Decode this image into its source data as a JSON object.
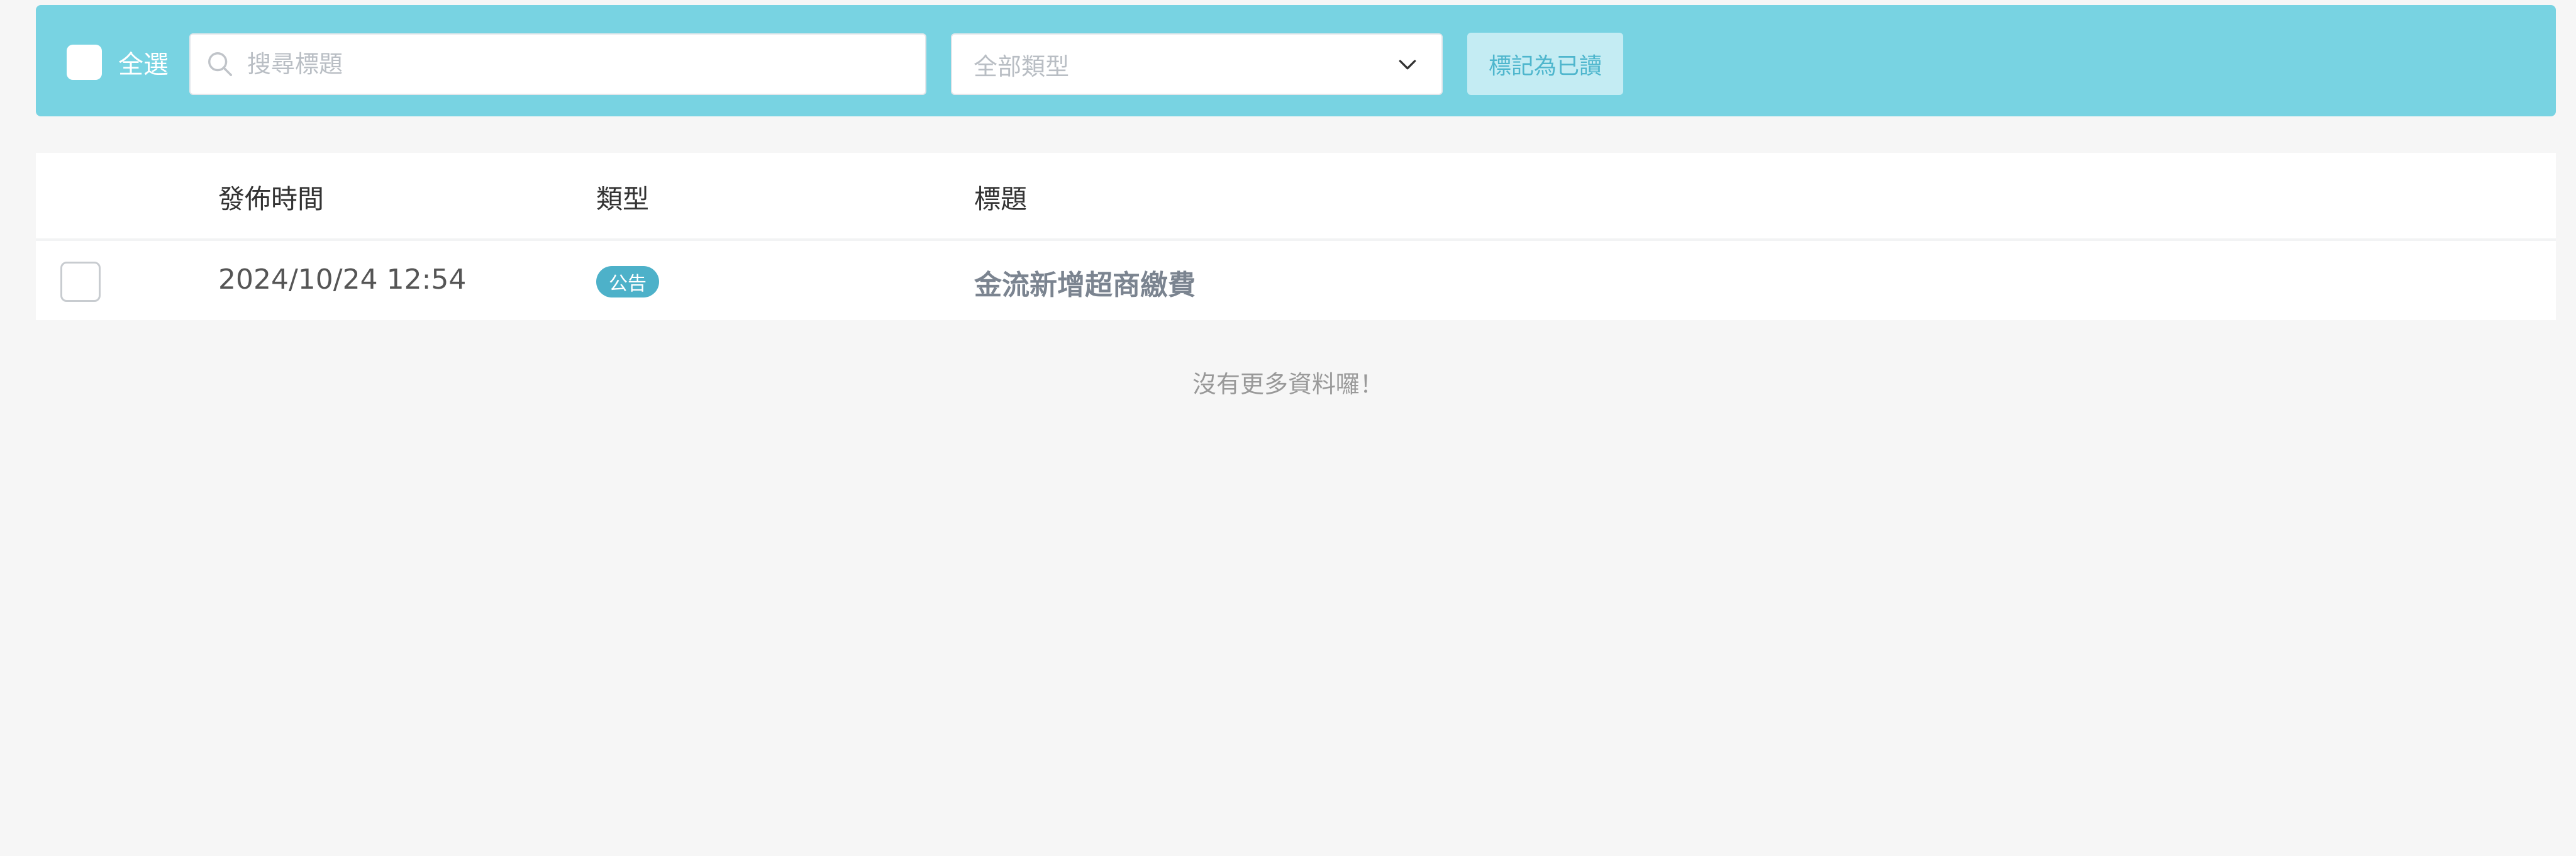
{
  "toolbar": {
    "select_all_label": "全選",
    "search_placeholder": "搜尋標題",
    "type_filter_value": "全部類型",
    "mark_read_label": "標記為已讀",
    "accent_color": "#78d3e2"
  },
  "table": {
    "headers": {
      "time": "發佈時間",
      "type": "類型",
      "title": "標題"
    },
    "rows": [
      {
        "time": "2024/10/24 12:54",
        "type": "公告",
        "title": "金流新增超商繳費",
        "checked": false
      }
    ]
  },
  "footer": {
    "no_more_text": "沒有更多資料囉！"
  },
  "icons": {
    "search": "search-icon",
    "dropdown": "chevron-down-icon"
  }
}
